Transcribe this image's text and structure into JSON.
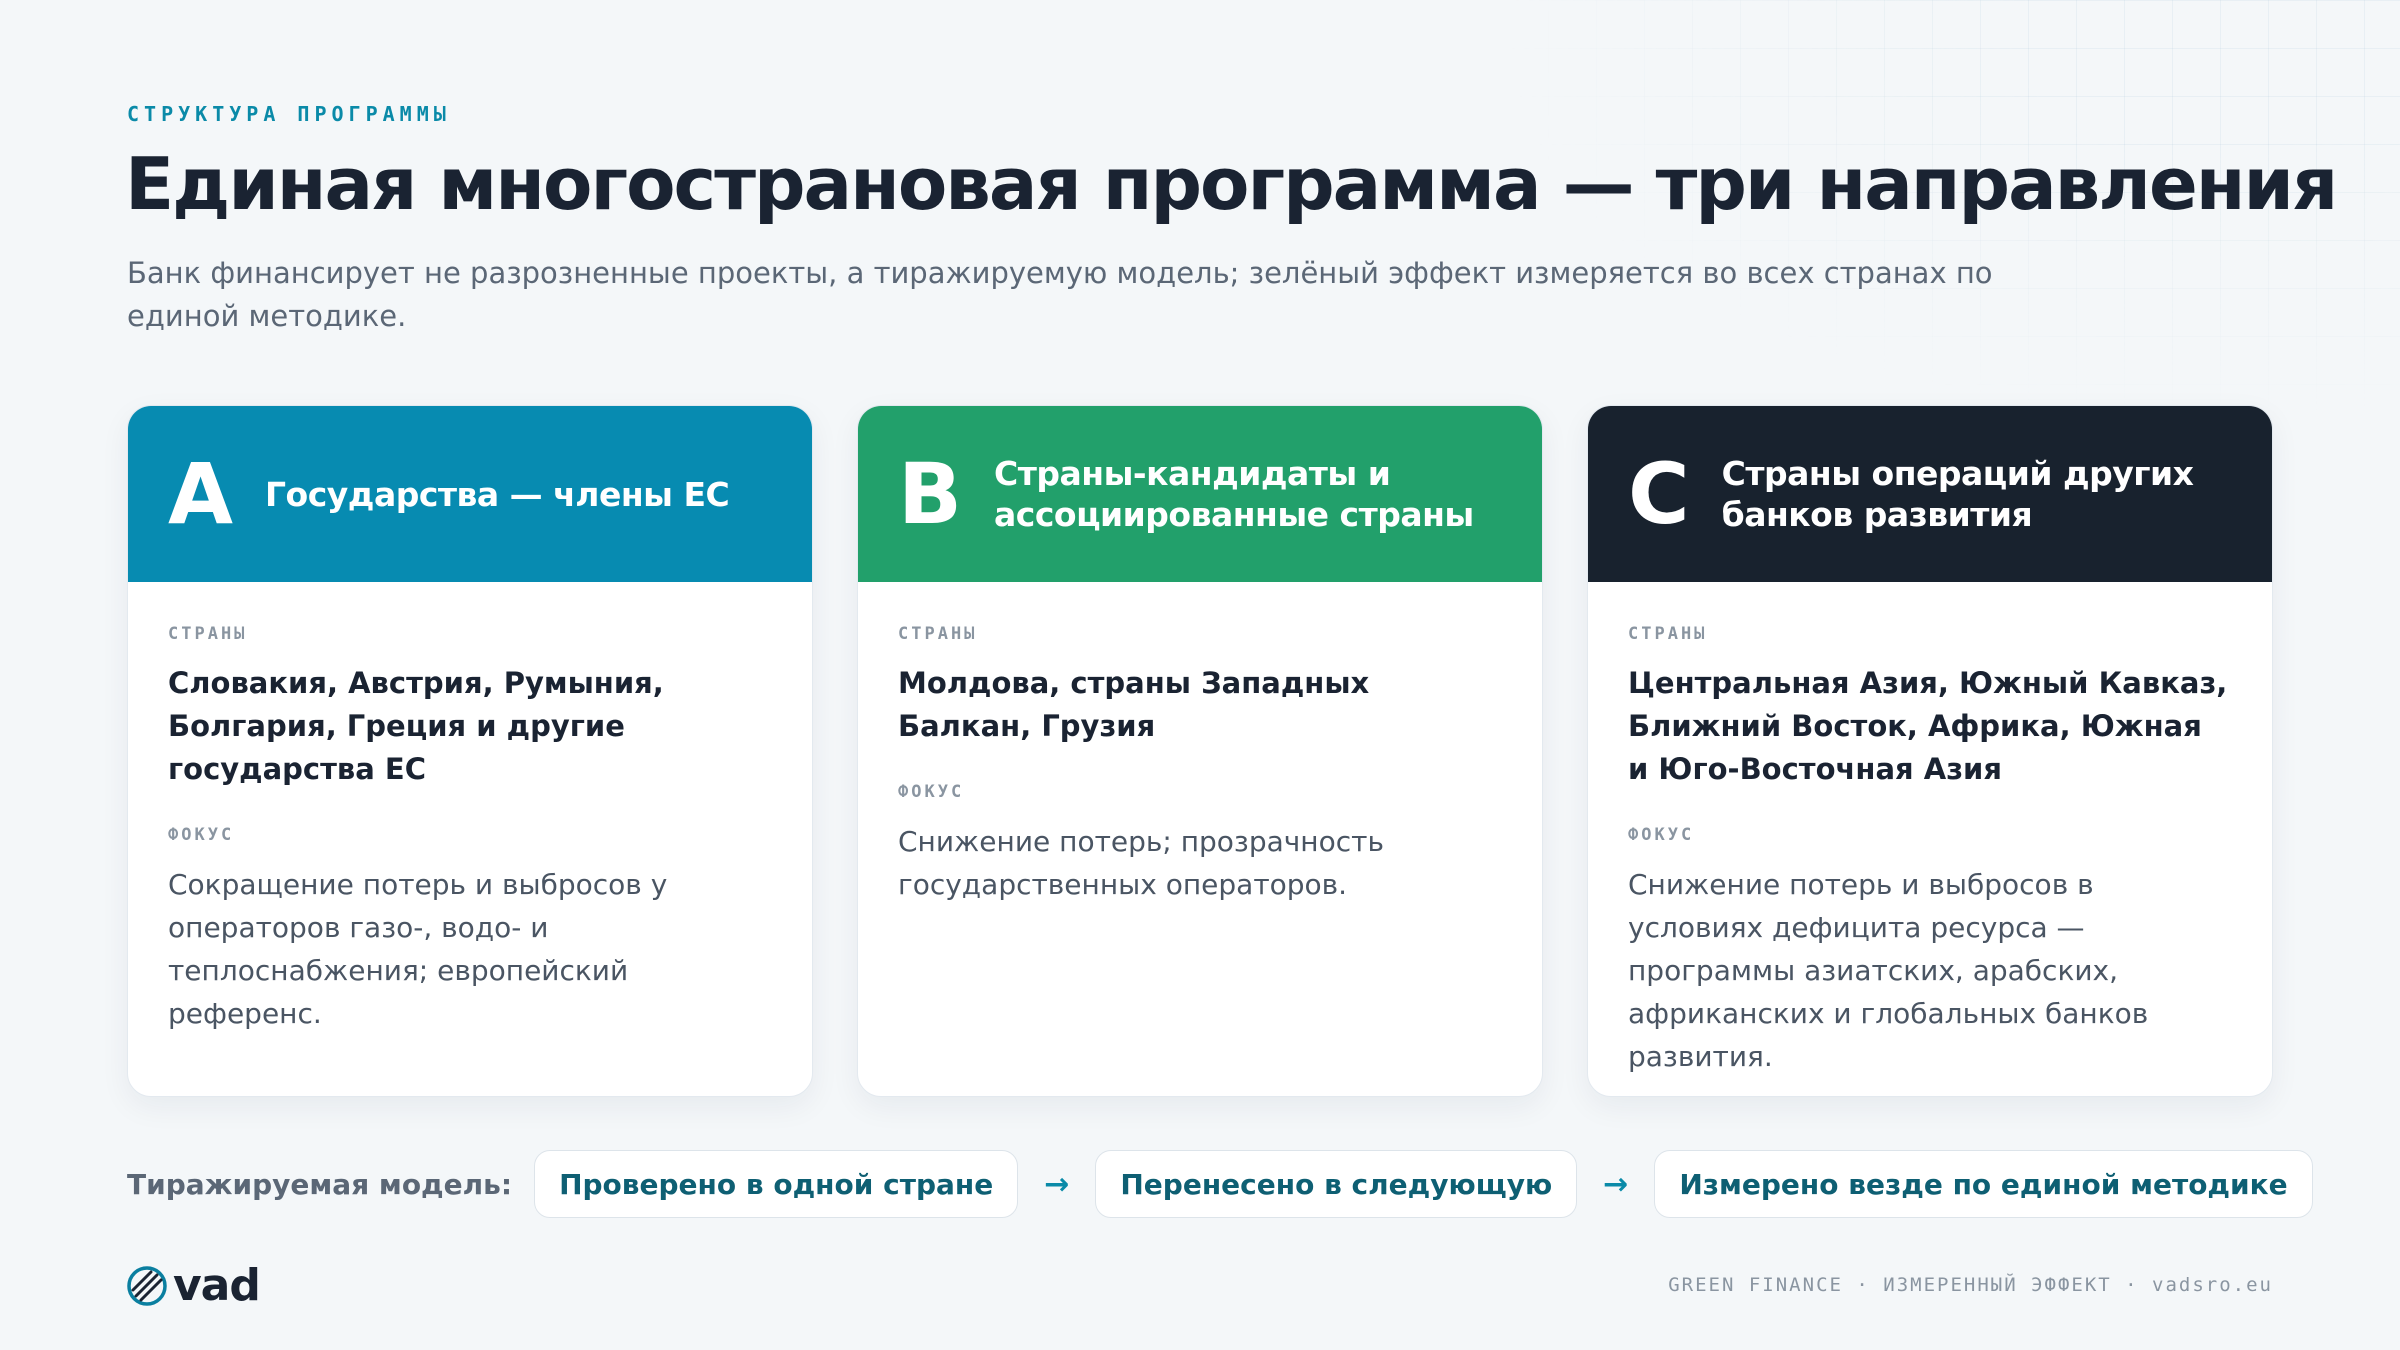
{
  "eyebrow": "СТРУКТУРА ПРОГРАММЫ",
  "title": "Единая многострановая программа — три направления",
  "subtitle": "Банк финансирует не разрозненные проекты, а тиражируемую модель; зелёный эффект измеряется во всех странах по единой методике.",
  "cards": [
    {
      "letter": "A",
      "title": "Государства — члены ЕС",
      "color": "#078bb1",
      "countries_label": "СТРАНЫ",
      "countries": "Словакия, Австрия, Румыния, Болгария, Греция и другие государства ЕС",
      "focus_label": "ФОКУС",
      "focus": "Сокращение потерь и выбросов у операторов газо-, водо- и теплоснабжения; европейский референс."
    },
    {
      "letter": "B",
      "title": "Страны-кандидаты и ассоциированные страны",
      "color": "#22a06b",
      "countries_label": "СТРАНЫ",
      "countries": "Молдова, страны Западных Балкан, Грузия",
      "focus_label": "ФОКУС",
      "focus": "Снижение потерь; прозрачность государственных операторов."
    },
    {
      "letter": "C",
      "title": "Страны операций других банков развития",
      "color": "#18222e",
      "countries_label": "СТРАНЫ",
      "countries": "Центральная Азия, Южный Кавказ, Ближний Восток, Африка, Южная и Юго-Восточная Азия",
      "focus_label": "ФОКУС",
      "focus": "Снижение потерь и выбросов в условиях дефицита ресурса — программы азиатских, арабских, африканских и глобальных банков развития."
    }
  ],
  "model": {
    "label": "Тиражируемая модель:",
    "steps": [
      "Проверено в одной стране",
      "Перенесено в следующую",
      "Измерено везде по единой методике"
    ],
    "arrow": "→"
  },
  "logo": {
    "text": "vad",
    "icon": "globe-icon"
  },
  "footer": "GREEN FINANCE · ИЗМЕРЕННЫЙ ЭФФЕКТ · vadsro.eu"
}
